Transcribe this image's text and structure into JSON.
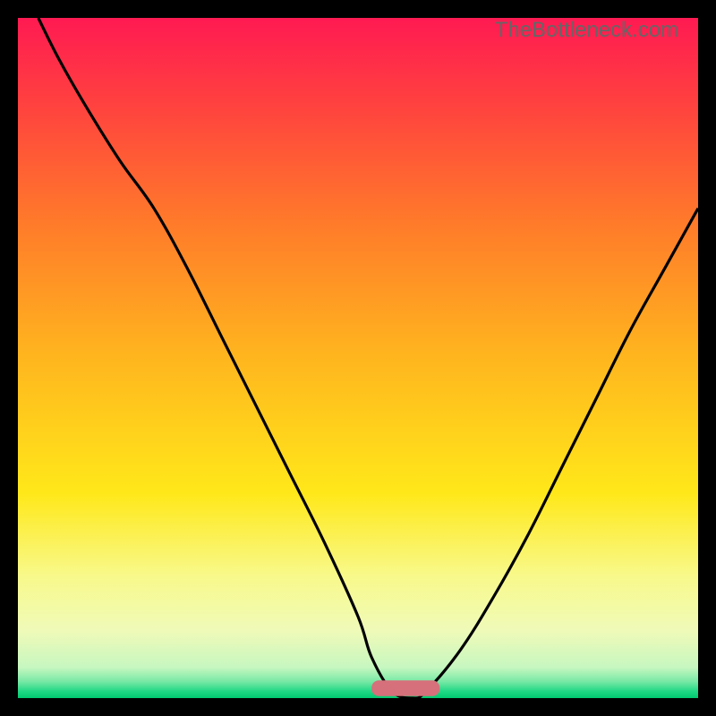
{
  "watermark": "TheBottleneck.com",
  "chart_data": {
    "type": "line",
    "title": "",
    "xlabel": "",
    "ylabel": "",
    "xlim": [
      0,
      100
    ],
    "ylim": [
      0,
      100
    ],
    "background": {
      "type": "vertical-gradient",
      "stops": [
        {
          "pos": 0.0,
          "color": "#ff1a52"
        },
        {
          "pos": 0.12,
          "color": "#ff3f40"
        },
        {
          "pos": 0.3,
          "color": "#ff7a2a"
        },
        {
          "pos": 0.5,
          "color": "#ffb61e"
        },
        {
          "pos": 0.7,
          "color": "#ffe81a"
        },
        {
          "pos": 0.82,
          "color": "#f8f98a"
        },
        {
          "pos": 0.9,
          "color": "#f0fab8"
        },
        {
          "pos": 0.955,
          "color": "#c7f7c0"
        },
        {
          "pos": 0.975,
          "color": "#7be9a6"
        },
        {
          "pos": 0.99,
          "color": "#20d884"
        },
        {
          "pos": 1.0,
          "color": "#00c96f"
        }
      ]
    },
    "series": [
      {
        "name": "bottleneck-curve",
        "color": "#000000",
        "x": [
          3,
          6,
          10,
          15,
          20,
          25,
          30,
          35,
          40,
          45,
          50,
          52,
          55,
          58,
          60,
          65,
          70,
          75,
          80,
          85,
          90,
          95,
          100
        ],
        "values": [
          100,
          94,
          87,
          79,
          72,
          63,
          53,
          43,
          33,
          23,
          12,
          6,
          1,
          0,
          1,
          7,
          15,
          24,
          34,
          44,
          54,
          63,
          72
        ]
      }
    ],
    "marker": {
      "name": "optimal-range",
      "shape": "rounded-bar",
      "color": "#d6707a",
      "x_start": 52,
      "x_end": 62,
      "y": 0.3,
      "height": 2.3
    }
  }
}
